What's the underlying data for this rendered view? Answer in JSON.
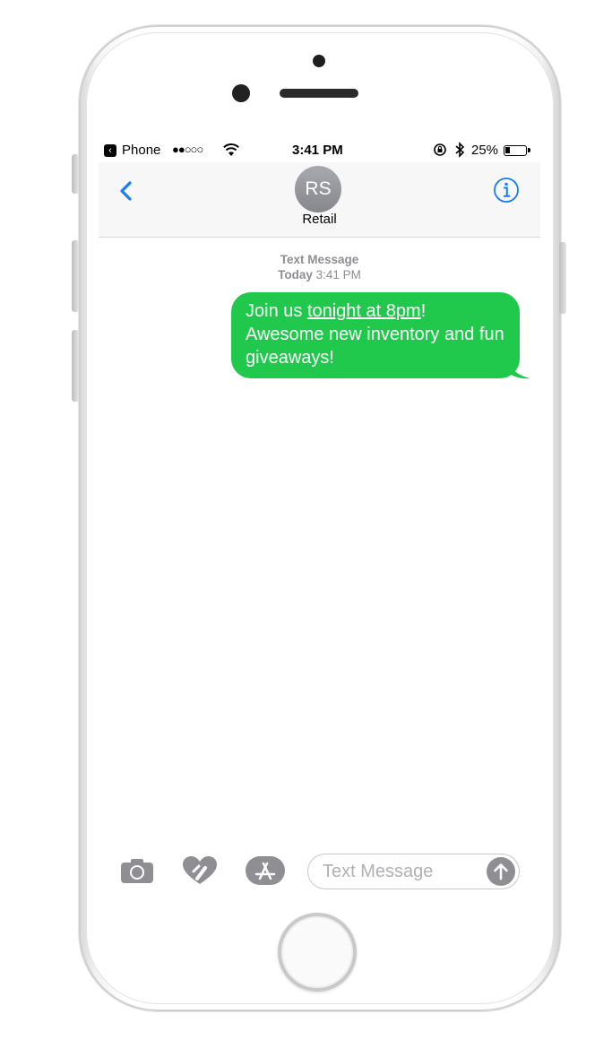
{
  "status_bar": {
    "carrier": "Phone",
    "signal": "●●○○○",
    "time": "3:41 PM",
    "battery": "25%",
    "battery_level": 0.25
  },
  "nav": {
    "avatar_initials": "RS",
    "contact_name": "Retail"
  },
  "conversation": {
    "service_label": "Text Message",
    "day_label": "Today",
    "time_label": "3:41 PM",
    "message": {
      "prefix": "Join us ",
      "link": "tonight at 8pm",
      "suffix": "! Awesome new inventory and fun giveaways!"
    }
  },
  "composer": {
    "placeholder": "Text Message"
  },
  "colors": {
    "ios_blue": "#1a7cf3",
    "imessage_green": "#20c94b",
    "gray_icon": "#8e8e93"
  },
  "icons": [
    "back-chevron-icon",
    "info-icon",
    "camera-icon",
    "digital-touch-heart-icon",
    "app-store-icon",
    "send-arrow-icon",
    "wifi-icon",
    "bluetooth-icon",
    "rotation-lock-icon",
    "battery-icon"
  ]
}
